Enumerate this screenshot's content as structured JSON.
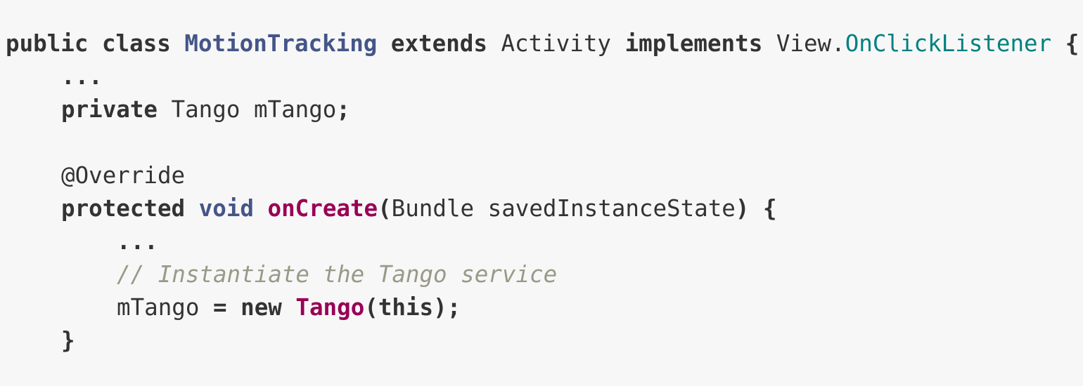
{
  "code": {
    "line1": {
      "kw1": "public",
      "kw2": "class",
      "class_name": "MotionTracking",
      "kw3": "extends",
      "parent": "Activity",
      "kw4": "implements",
      "iface_prefix": "View.",
      "iface_name": "OnClickListener",
      "brace": "{"
    },
    "line2": {
      "ellipsis": "..."
    },
    "line3": {
      "kw": "private",
      "type": "Tango",
      "field": "mTango",
      "semi": ";"
    },
    "line5": {
      "annotation": "@Override"
    },
    "line6": {
      "kw": "protected",
      "ret": "void",
      "method": "onCreate",
      "open_paren": "(",
      "param_type": "Bundle",
      "param_name": "savedInstanceState",
      "close_paren": ")",
      "brace": "{"
    },
    "line7": {
      "ellipsis": "..."
    },
    "line8": {
      "comment": "// Instantiate the Tango service"
    },
    "line9": {
      "var": "mTango",
      "eq": "=",
      "kw": "new",
      "ctor": "Tango",
      "open_paren": "(",
      "arg": "this",
      "close_paren": ")",
      "semi": ";"
    },
    "line10": {
      "brace": "}"
    }
  },
  "colors": {
    "background": "#f7f7f7",
    "text": "#333333",
    "class_name": "#445588",
    "type_ref": "#008080",
    "function": "#990055",
    "comment": "#999988"
  }
}
